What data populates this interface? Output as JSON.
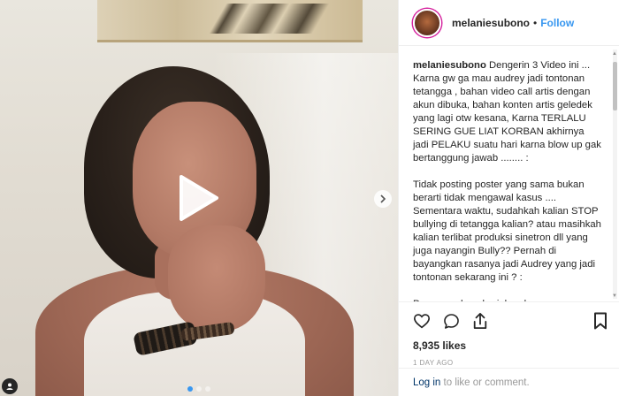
{
  "post": {
    "username": "melaniesubono",
    "separator": "•",
    "follow_label": "Follow",
    "caption_user": "melaniesubono",
    "caption_text": " Dengerin 3 Video ini ...\nKarna gw ga mau audrey jadi tontonan tetangga , bahan video call artis dengan akun dibuka, bahan konten artis geledek yang lagi otw kesana, Karna TERLALU SERING GUE LIAT KORBAN akhirnya jadi PELAKU suatu hari karna blow up gak bertanggung jawab ........ :\n\nTidak posting poster yang sama bukan berarti tidak mengawal kasus .... Sementara waktu, sudahkah kalian STOP bullying di tetangga kalian? atau masihkah kalian terlibat produksi sinetron dll yang juga nayangin Bully?? Pernah di bayangkan rasanya jadi Audrey yang jadi tontonan sekarang ini ? :\n\nProses sedang berjalan dan gue mengawal Gue pun meminta beberapa media online",
    "likes": "8,935 likes",
    "time_ago": "1 DAY AGO",
    "login_link": "Log in",
    "login_rest": " to like or comment."
  },
  "media": {
    "carousel_count": 3,
    "carousel_active": 0
  },
  "icons": {
    "play": "play-icon",
    "next": "chevron-right-icon",
    "like": "heart-icon",
    "comment": "comment-icon",
    "share": "share-icon",
    "save": "bookmark-icon"
  },
  "colors": {
    "link_blue": "#3897f0",
    "text": "#262626",
    "muted": "#999999"
  }
}
